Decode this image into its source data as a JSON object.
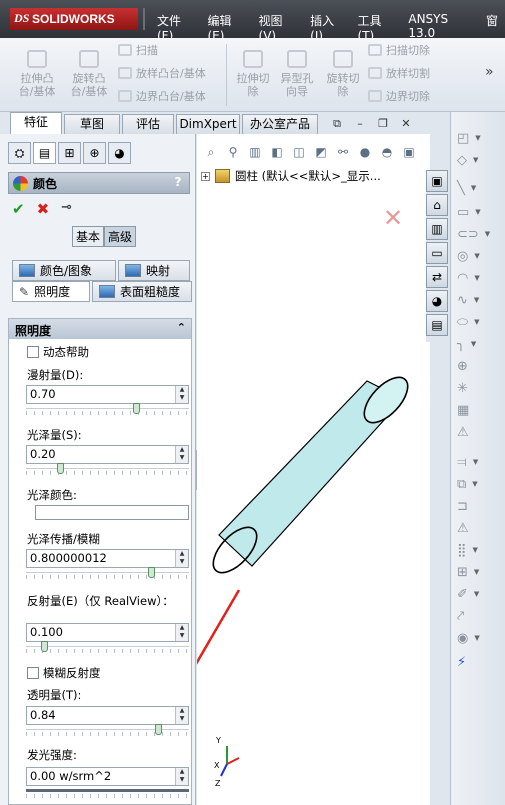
{
  "app": {
    "logo_text": "SOLIDWORKS",
    "logo_prefix": "DS"
  },
  "menus": [
    "文件(F)",
    "编辑(E)",
    "视图(V)",
    "插入(I)",
    "工具(T)",
    "ANSYS 13.0",
    "窗"
  ],
  "command_manager": {
    "big_buttons": [
      {
        "label": "拉伸凸\n台/基体"
      },
      {
        "label": "旋转凸\n台/基体"
      },
      {
        "label": "拉伸切\n除"
      },
      {
        "label": "异型孔\n向导"
      },
      {
        "label": "旋转切\n除"
      }
    ],
    "small_buttons": [
      "扫描",
      "放样凸台/基体",
      "边界凸台/基体",
      "扫描切除",
      "放样切割",
      "边界切除"
    ],
    "more": "»"
  },
  "tabs": [
    "特征",
    "草图",
    "评估",
    "DimXpert",
    "办公室产品"
  ],
  "active_tab": "特征",
  "property_manager": {
    "title": "颜色",
    "help": "?",
    "ok": "✔",
    "cancel": "✖",
    "pin": "⊸",
    "modes": [
      "基本",
      "高级"
    ],
    "subtabs": [
      "颜色/图象",
      "映射",
      "照明度",
      "表面粗糙度"
    ],
    "group_title": "照明度",
    "dynamic_help": "动态帮助",
    "diffuse_label": "漫射量(D):",
    "diffuse_value": "0.70",
    "diffuse_level": 0.7,
    "gloss_label": "光泽量(S):",
    "gloss_value": "0.20",
    "gloss_level": 0.2,
    "gloss_color_label": "光泽颜色:",
    "spread_label": "光泽传播/模糊",
    "spread_value": "0.800000012",
    "spread_level": 0.8,
    "reflect_label": "反射量(E)（仅 RealView）：",
    "reflect_value": "0.100",
    "reflect_level": 0.1,
    "blur_reflect": "模糊反射度",
    "transparency_label": "透明量(T):",
    "transparency_value": "0.84",
    "transparency_level": 0.84,
    "emission_label": "发光强度:",
    "emission_value": "0.00 w/srm^2"
  },
  "viewport": {
    "tree_label": "圆柱  (默认<<默认>_显示...",
    "triad_labels": [
      "Y",
      "X",
      "Z"
    ]
  },
  "colors": {
    "arrow": "#e0221b",
    "cylinder": "#bfe9ea"
  }
}
